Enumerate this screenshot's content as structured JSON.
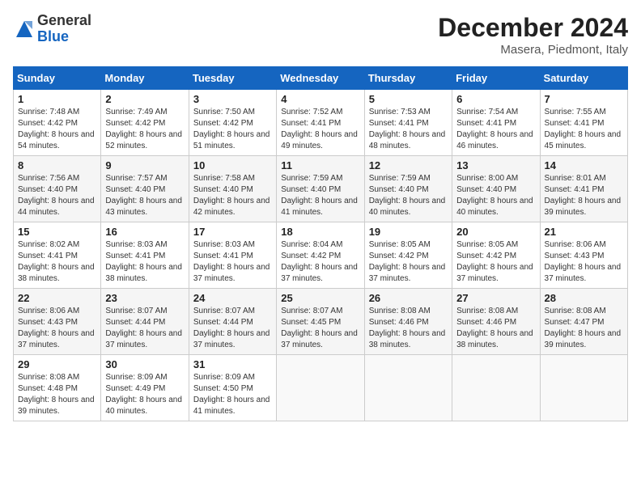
{
  "header": {
    "logo_line1": "General",
    "logo_line2": "Blue",
    "month_title": "December 2024",
    "location": "Masera, Piedmont, Italy"
  },
  "weekdays": [
    "Sunday",
    "Monday",
    "Tuesday",
    "Wednesday",
    "Thursday",
    "Friday",
    "Saturday"
  ],
  "weeks": [
    [
      {
        "day": "1",
        "sunrise": "Sunrise: 7:48 AM",
        "sunset": "Sunset: 4:42 PM",
        "daylight": "Daylight: 8 hours and 54 minutes."
      },
      {
        "day": "2",
        "sunrise": "Sunrise: 7:49 AM",
        "sunset": "Sunset: 4:42 PM",
        "daylight": "Daylight: 8 hours and 52 minutes."
      },
      {
        "day": "3",
        "sunrise": "Sunrise: 7:50 AM",
        "sunset": "Sunset: 4:42 PM",
        "daylight": "Daylight: 8 hours and 51 minutes."
      },
      {
        "day": "4",
        "sunrise": "Sunrise: 7:52 AM",
        "sunset": "Sunset: 4:41 PM",
        "daylight": "Daylight: 8 hours and 49 minutes."
      },
      {
        "day": "5",
        "sunrise": "Sunrise: 7:53 AM",
        "sunset": "Sunset: 4:41 PM",
        "daylight": "Daylight: 8 hours and 48 minutes."
      },
      {
        "day": "6",
        "sunrise": "Sunrise: 7:54 AM",
        "sunset": "Sunset: 4:41 PM",
        "daylight": "Daylight: 8 hours and 46 minutes."
      },
      {
        "day": "7",
        "sunrise": "Sunrise: 7:55 AM",
        "sunset": "Sunset: 4:41 PM",
        "daylight": "Daylight: 8 hours and 45 minutes."
      }
    ],
    [
      {
        "day": "8",
        "sunrise": "Sunrise: 7:56 AM",
        "sunset": "Sunset: 4:40 PM",
        "daylight": "Daylight: 8 hours and 44 minutes."
      },
      {
        "day": "9",
        "sunrise": "Sunrise: 7:57 AM",
        "sunset": "Sunset: 4:40 PM",
        "daylight": "Daylight: 8 hours and 43 minutes."
      },
      {
        "day": "10",
        "sunrise": "Sunrise: 7:58 AM",
        "sunset": "Sunset: 4:40 PM",
        "daylight": "Daylight: 8 hours and 42 minutes."
      },
      {
        "day": "11",
        "sunrise": "Sunrise: 7:59 AM",
        "sunset": "Sunset: 4:40 PM",
        "daylight": "Daylight: 8 hours and 41 minutes."
      },
      {
        "day": "12",
        "sunrise": "Sunrise: 7:59 AM",
        "sunset": "Sunset: 4:40 PM",
        "daylight": "Daylight: 8 hours and 40 minutes."
      },
      {
        "day": "13",
        "sunrise": "Sunrise: 8:00 AM",
        "sunset": "Sunset: 4:40 PM",
        "daylight": "Daylight: 8 hours and 40 minutes."
      },
      {
        "day": "14",
        "sunrise": "Sunrise: 8:01 AM",
        "sunset": "Sunset: 4:41 PM",
        "daylight": "Daylight: 8 hours and 39 minutes."
      }
    ],
    [
      {
        "day": "15",
        "sunrise": "Sunrise: 8:02 AM",
        "sunset": "Sunset: 4:41 PM",
        "daylight": "Daylight: 8 hours and 38 minutes."
      },
      {
        "day": "16",
        "sunrise": "Sunrise: 8:03 AM",
        "sunset": "Sunset: 4:41 PM",
        "daylight": "Daylight: 8 hours and 38 minutes."
      },
      {
        "day": "17",
        "sunrise": "Sunrise: 8:03 AM",
        "sunset": "Sunset: 4:41 PM",
        "daylight": "Daylight: 8 hours and 37 minutes."
      },
      {
        "day": "18",
        "sunrise": "Sunrise: 8:04 AM",
        "sunset": "Sunset: 4:42 PM",
        "daylight": "Daylight: 8 hours and 37 minutes."
      },
      {
        "day": "19",
        "sunrise": "Sunrise: 8:05 AM",
        "sunset": "Sunset: 4:42 PM",
        "daylight": "Daylight: 8 hours and 37 minutes."
      },
      {
        "day": "20",
        "sunrise": "Sunrise: 8:05 AM",
        "sunset": "Sunset: 4:42 PM",
        "daylight": "Daylight: 8 hours and 37 minutes."
      },
      {
        "day": "21",
        "sunrise": "Sunrise: 8:06 AM",
        "sunset": "Sunset: 4:43 PM",
        "daylight": "Daylight: 8 hours and 37 minutes."
      }
    ],
    [
      {
        "day": "22",
        "sunrise": "Sunrise: 8:06 AM",
        "sunset": "Sunset: 4:43 PM",
        "daylight": "Daylight: 8 hours and 37 minutes."
      },
      {
        "day": "23",
        "sunrise": "Sunrise: 8:07 AM",
        "sunset": "Sunset: 4:44 PM",
        "daylight": "Daylight: 8 hours and 37 minutes."
      },
      {
        "day": "24",
        "sunrise": "Sunrise: 8:07 AM",
        "sunset": "Sunset: 4:44 PM",
        "daylight": "Daylight: 8 hours and 37 minutes."
      },
      {
        "day": "25",
        "sunrise": "Sunrise: 8:07 AM",
        "sunset": "Sunset: 4:45 PM",
        "daylight": "Daylight: 8 hours and 37 minutes."
      },
      {
        "day": "26",
        "sunrise": "Sunrise: 8:08 AM",
        "sunset": "Sunset: 4:46 PM",
        "daylight": "Daylight: 8 hours and 38 minutes."
      },
      {
        "day": "27",
        "sunrise": "Sunrise: 8:08 AM",
        "sunset": "Sunset: 4:46 PM",
        "daylight": "Daylight: 8 hours and 38 minutes."
      },
      {
        "day": "28",
        "sunrise": "Sunrise: 8:08 AM",
        "sunset": "Sunset: 4:47 PM",
        "daylight": "Daylight: 8 hours and 39 minutes."
      }
    ],
    [
      {
        "day": "29",
        "sunrise": "Sunrise: 8:08 AM",
        "sunset": "Sunset: 4:48 PM",
        "daylight": "Daylight: 8 hours and 39 minutes."
      },
      {
        "day": "30",
        "sunrise": "Sunrise: 8:09 AM",
        "sunset": "Sunset: 4:49 PM",
        "daylight": "Daylight: 8 hours and 40 minutes."
      },
      {
        "day": "31",
        "sunrise": "Sunrise: 8:09 AM",
        "sunset": "Sunset: 4:50 PM",
        "daylight": "Daylight: 8 hours and 41 minutes."
      },
      null,
      null,
      null,
      null
    ]
  ]
}
